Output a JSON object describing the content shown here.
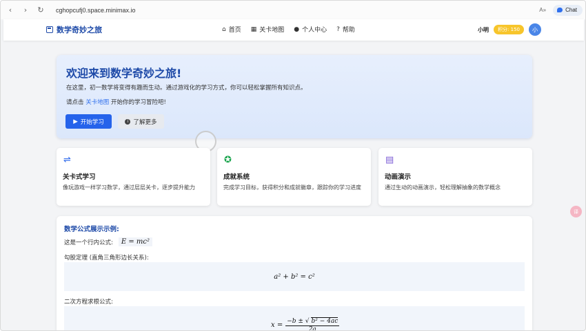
{
  "browser": {
    "url": "cghopcufj0.space.minimax.io",
    "back_icon": "‹",
    "forward_icon": "›",
    "reload_icon": "↻",
    "reader_label": "A»",
    "chat_label": "Chat"
  },
  "header": {
    "brand": "数学奇妙之旅",
    "nav": [
      {
        "icon": "home-icon",
        "glyph": "⌂",
        "label": "首页"
      },
      {
        "icon": "map-icon",
        "glyph": "▦",
        "label": "关卡地图"
      },
      {
        "icon": "user-icon",
        "glyph": "●",
        "label": "个人中心"
      },
      {
        "icon": "help-icon",
        "glyph": "?",
        "label": "帮助"
      }
    ],
    "user_name": "小明",
    "points": "积分: 150",
    "avatar": "小"
  },
  "hero": {
    "title": "欢迎来到数学奇妙之旅!",
    "description": "在这里，初一数学将变得有趣而生动。通过游戏化的学习方式，你可以轻松掌握所有知识点。",
    "prompt_prefix": "请点击",
    "prompt_link": "关卡地图",
    "prompt_suffix": "开始你的学习冒险吧!",
    "start_button": "开始学习",
    "more_button": "了解更多",
    "colors": {
      "accent": "#1e4aa8",
      "button": "#2563eb"
    }
  },
  "features": [
    {
      "icon": "signpost-icon",
      "glyph": "⇌",
      "color": "#2563eb",
      "title": "关卡式学习",
      "description": "像玩游戏一样学习数学，通过层层关卡，逐步提升能力"
    },
    {
      "icon": "medal-icon",
      "glyph": "✪",
      "color": "#16a34a",
      "title": "成就系统",
      "description": "完成学习目标，获得积分和成就徽章，跟踪你的学习进度"
    },
    {
      "icon": "film-icon",
      "glyph": "▤",
      "color": "#7c5cd6",
      "title": "动画演示",
      "description": "通过生动的动画演示，轻松理解抽象的数学概念"
    }
  ],
  "formulas": {
    "title": "数学公式展示示例:",
    "inline_label": "这是一个行内公式:",
    "inline_formula": "E = mc²",
    "pythagoras_label": "勾股定理 (直角三角形边长关系):",
    "pythagoras_formula": "a² + b² = c²",
    "quadratic_label": "二次方程求根公式:",
    "quadratic_lhs": "x =",
    "quadratic_numerator": "−b ± √",
    "quadratic_radicand": "b² − 4ac",
    "quadratic_denominator": "2a"
  },
  "floating_button": "译"
}
